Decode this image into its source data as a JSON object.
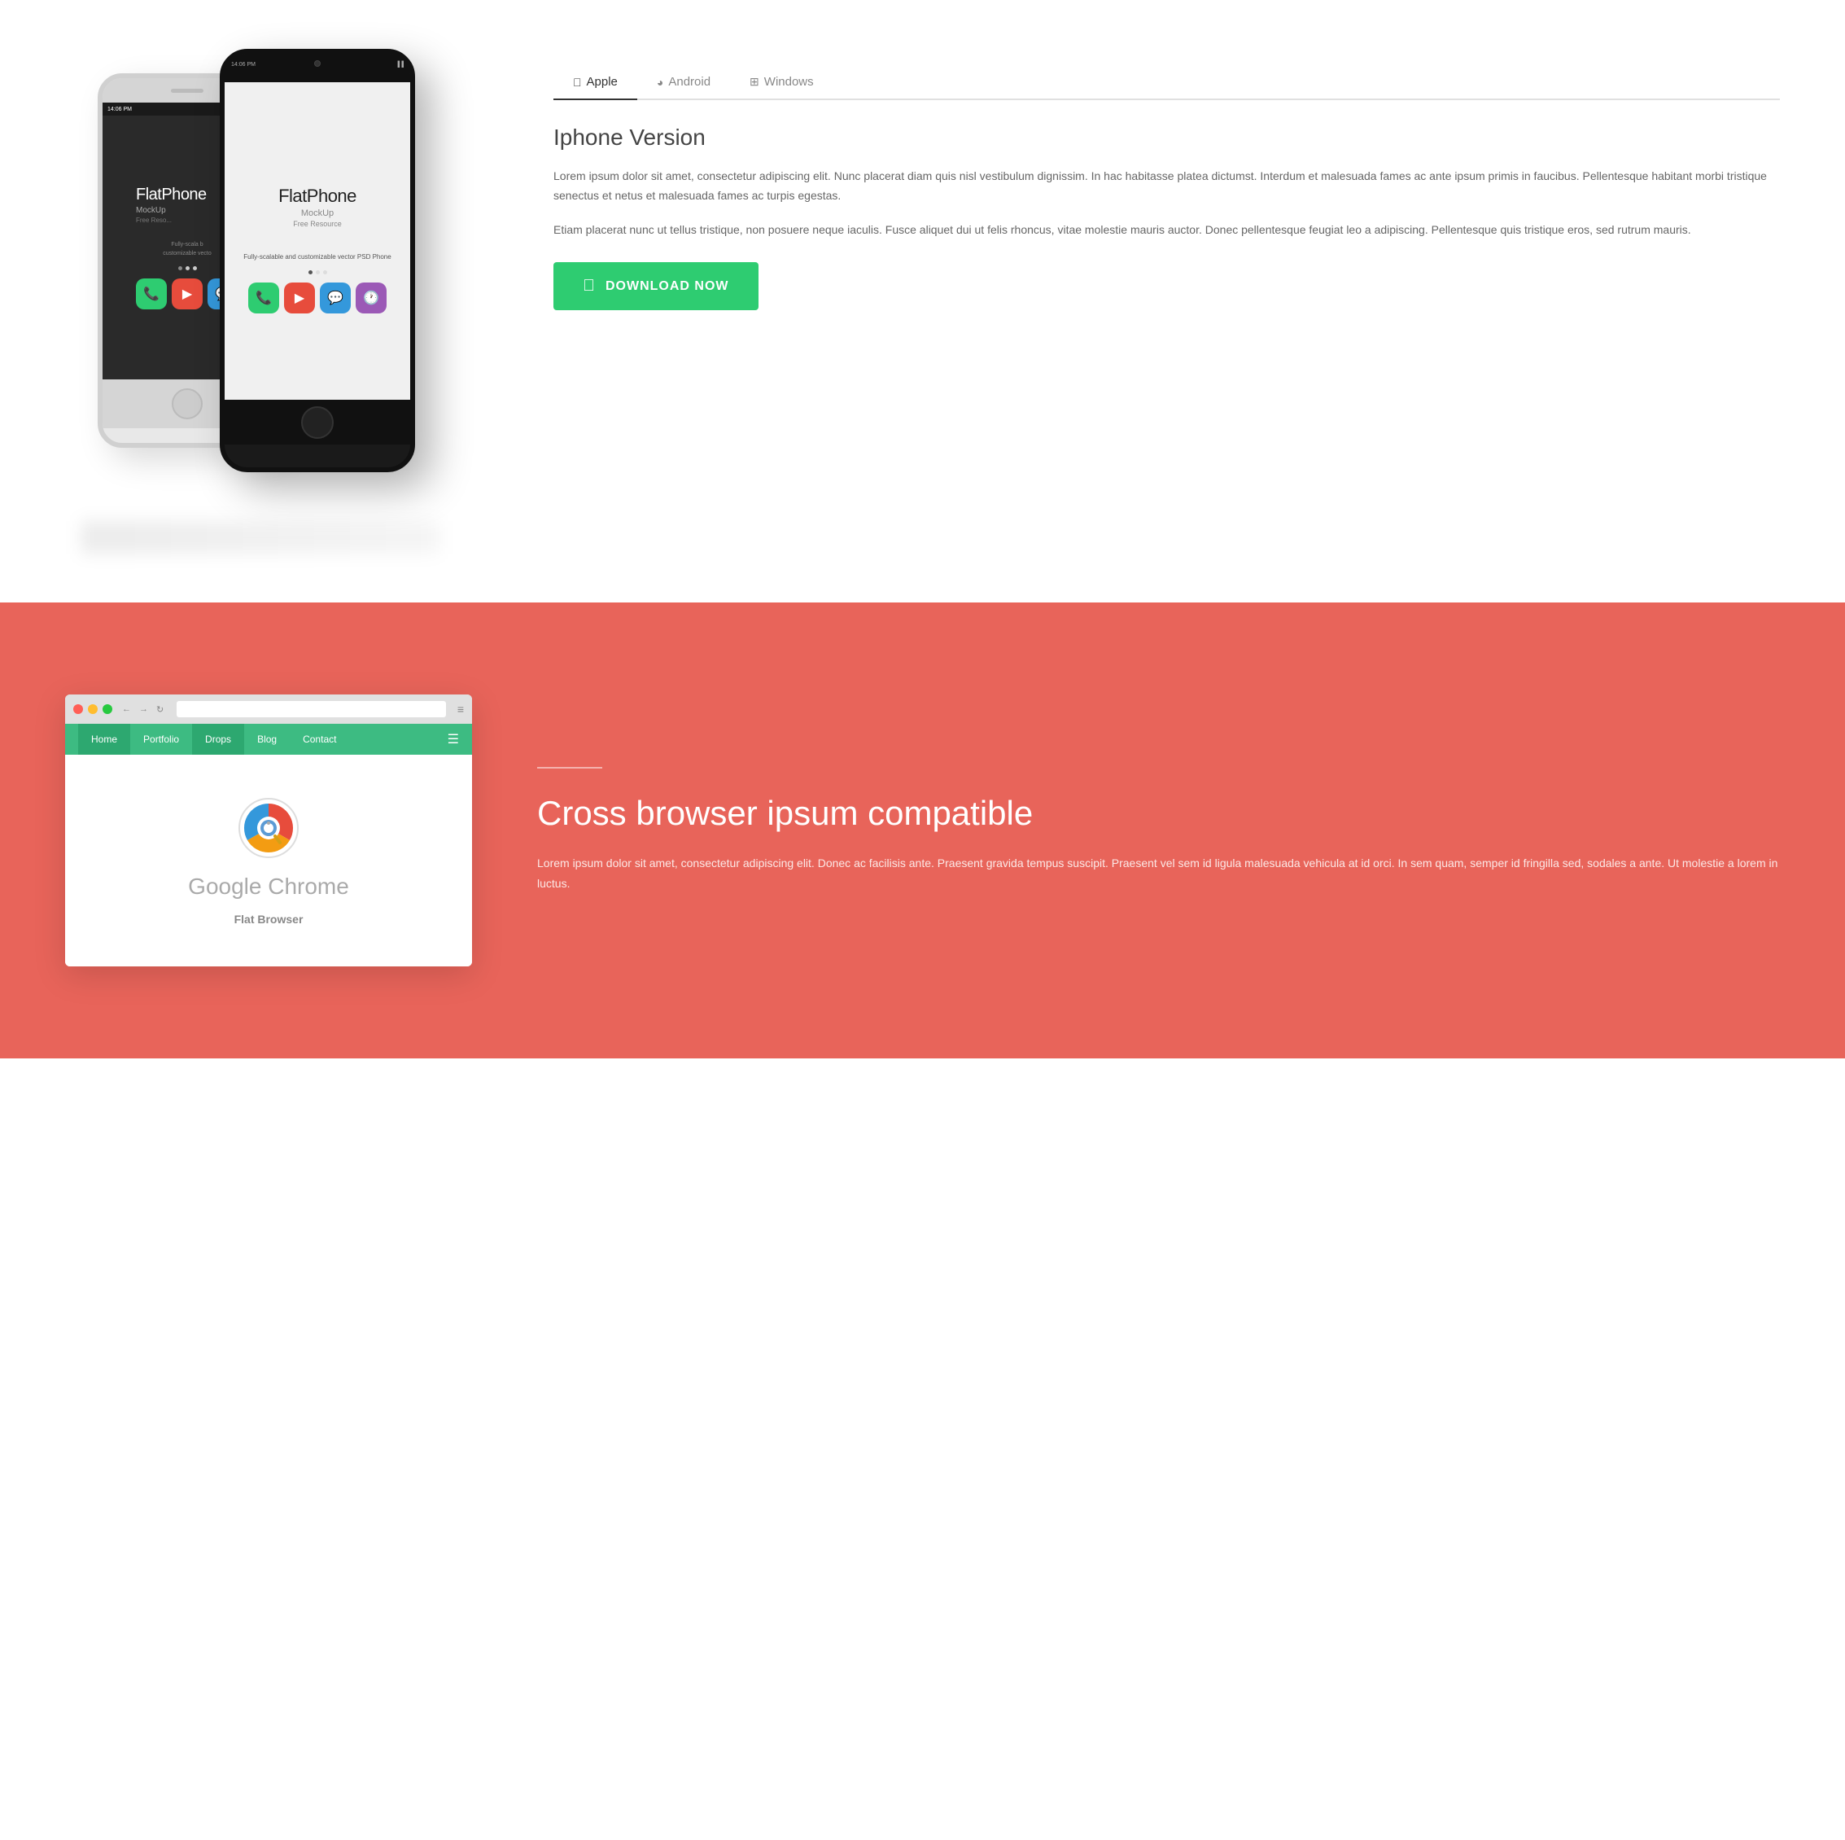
{
  "section_top": {
    "background": "#ffffff"
  },
  "phones": {
    "white_phone": {
      "app_name_bold": "FlatPh",
      "app_name_light": "",
      "mockup_label": "MockU",
      "free_resource": "Free Reso...",
      "tagline": "Fully-scala b\ncustomizable vecto",
      "status_time": "14:06 PM"
    },
    "black_phone": {
      "app_name_bold": "Flat",
      "app_name_bold2": "Phone",
      "mockup_label": "MockUp",
      "free_resource": "Free Resource",
      "tagline": "Fully-scalable and\ncustomizable vector PSD Phone",
      "status_time": "14:06 PM"
    }
  },
  "tabs": [
    {
      "id": "apple",
      "label": "Apple",
      "icon": "apple",
      "active": true
    },
    {
      "id": "android",
      "label": "Android",
      "icon": "android",
      "active": false
    },
    {
      "id": "windows",
      "label": "Windows",
      "icon": "windows",
      "active": false
    }
  ],
  "content": {
    "title": "Iphone Version",
    "paragraph1": "Lorem ipsum dolor sit amet, consectetur adipiscing elit. Nunc placerat diam quis nisl vestibulum dignissim. In hac habitasse platea dictumst. Interdum et malesuada fames ac ante ipsum primis in faucibus. Pellentesque habitant morbi tristique senectus et netus et malesuada fames ac turpis egestas.",
    "paragraph2": "Etiam placerat nunc ut tellus tristique, non posuere neque iaculis. Fusce aliquet dui ut felis rhoncus, vitae molestie mauris auctor. Donec pellentesque feugiat leo a adipiscing. Pellentesque quis tristique eros, sed rutrum mauris.",
    "download_btn": "DOWNLOAD NOW"
  },
  "section_bottom": {
    "background": "#e8645a"
  },
  "browser": {
    "nav_items": [
      "Home",
      "Portfolio",
      "Drops",
      "Blog",
      "Contact"
    ],
    "active_nav": "Drops",
    "app_name": "Google Chrome",
    "app_subtitle": "Flat Browser"
  },
  "cross_browser": {
    "title": "Cross browser ipsum compatible",
    "description": "Lorem ipsum dolor sit amet, consectetur adipiscing elit. Donec ac facilisis ante. Praesent gravida tempus suscipit. Praesent vel sem id ligula malesuada vehicula at id orci. In sem quam, semper id fringilla sed, sodales a ante. Ut molestie a lorem in luctus."
  }
}
